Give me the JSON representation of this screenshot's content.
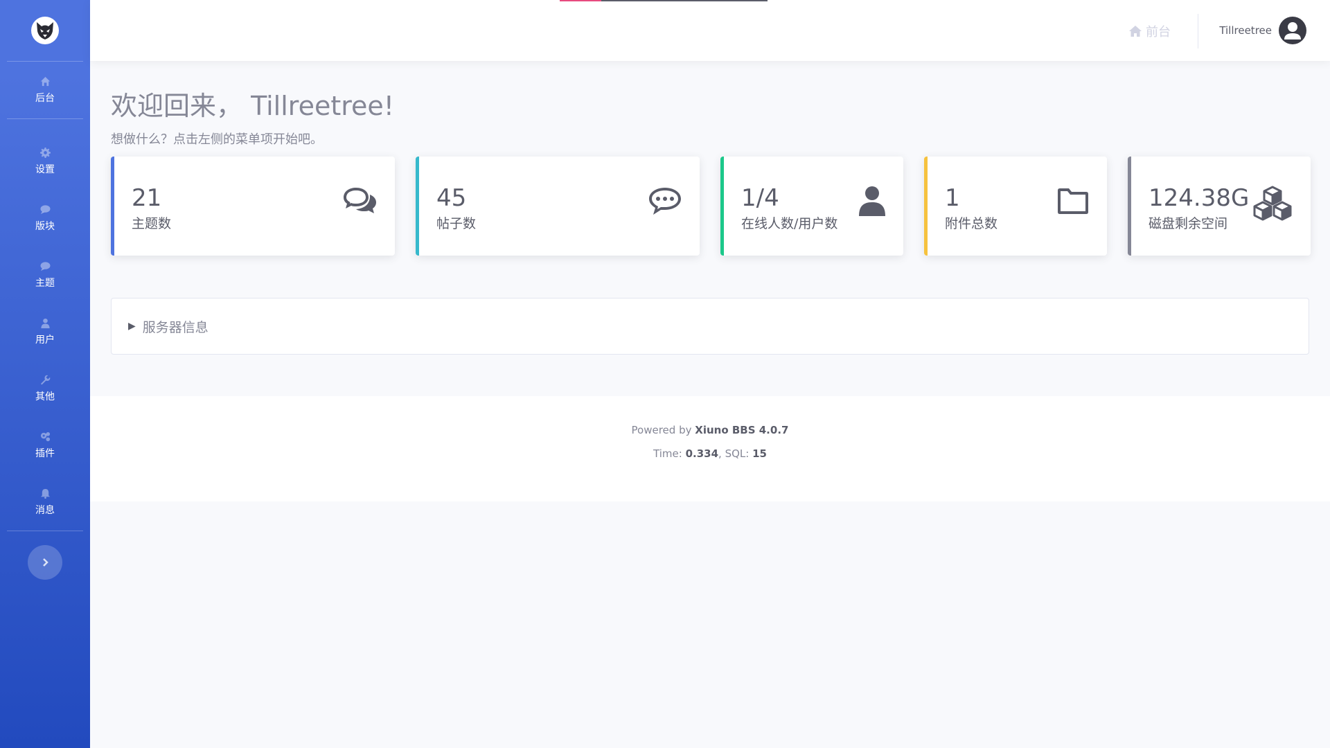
{
  "sidebar": {
    "logo_icon": "brand-mask-icon",
    "items": [
      {
        "label": "后台",
        "icon": "home-icon"
      },
      {
        "label": "设置",
        "icon": "gear-icon"
      },
      {
        "label": "版块",
        "icon": "chat-bubble-icon"
      },
      {
        "label": "主题",
        "icon": "chat-bubble-icon"
      },
      {
        "label": "用户",
        "icon": "user-icon"
      },
      {
        "label": "其他",
        "icon": "wrench-icon"
      },
      {
        "label": "插件",
        "icon": "gears-icon"
      },
      {
        "label": "消息",
        "icon": "bell-icon"
      }
    ],
    "toggle_icon": "chevron-right-icon"
  },
  "topbar": {
    "front_label": "前台",
    "username": "Tillreetree"
  },
  "main": {
    "welcome": "欢迎回来， Tillreetree!",
    "subtitle": "想做什么？点击左侧的菜单项开始吧。",
    "cards": [
      {
        "value": "21",
        "label": "主题数",
        "color": "#4e73df",
        "icon": "comments-icon"
      },
      {
        "value": "45",
        "label": "帖子数",
        "color": "#36b9cc",
        "icon": "commenting-icon"
      },
      {
        "value": "1/4",
        "label": "在线人数/用户数",
        "color": "#1cc88a",
        "icon": "user-icon"
      },
      {
        "value": "1",
        "label": "附件总数",
        "color": "#f6c23e",
        "icon": "folder-icon"
      },
      {
        "value": "124.38G",
        "label": "磁盘剩余空间",
        "color": "#858796",
        "icon": "cubes-icon"
      }
    ],
    "server_info": "服务器信息"
  },
  "footer": {
    "powered_prefix": "Powered by",
    "powered_name": "Xiuno BBS 4.0.7",
    "time_label": "Time:",
    "time_value": "0.334",
    "sql_label": "SQL:",
    "sql_value": "15"
  }
}
